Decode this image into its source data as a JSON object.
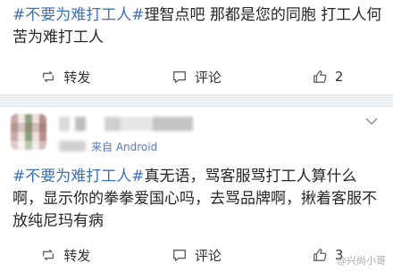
{
  "post1": {
    "tag": "#不要为难打工人#",
    "text": "理智点吧 那都是您的同胞 打工人何苦为难打工人",
    "actions": {
      "repost_label": "转发",
      "comment_label": "评论",
      "like_count": "2"
    }
  },
  "post2": {
    "meta_source": "来自 Android",
    "tag": "#不要为难打工人#",
    "text": "真无语，骂客服骂打工人算什么啊，显示你的拳拳爱国心吗，去骂品牌啊，揪着客服不放纯尼玛有病",
    "actions": {
      "repost_label": "转发",
      "comment_label": "评论",
      "like_count": "3"
    }
  },
  "watermark": "@兴尚小哥",
  "colors": {
    "link_blue": "#3e6fb4",
    "divider": "#eef0f2",
    "icon_gray": "#666666"
  },
  "icons": [
    "repost-icon",
    "comment-icon",
    "like-icon",
    "chevron-down-icon"
  ]
}
